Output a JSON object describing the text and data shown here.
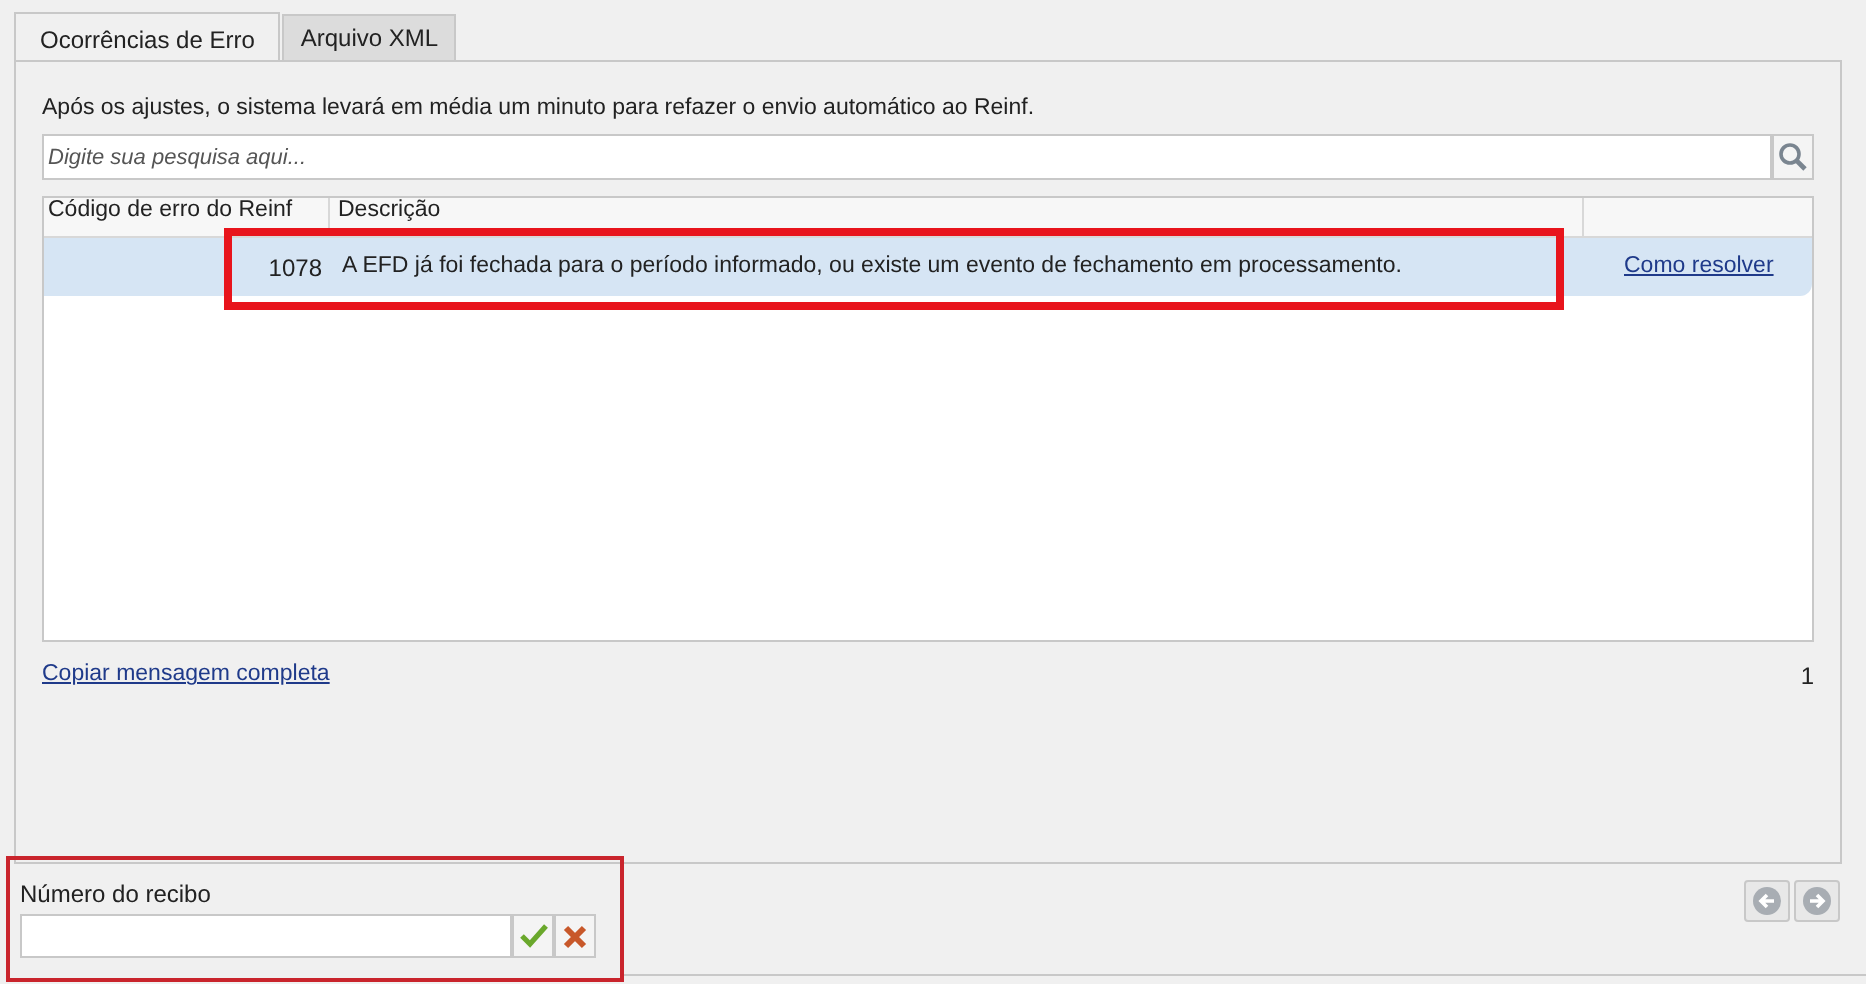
{
  "tabs": [
    {
      "label": "Ocorrências de Erro",
      "selected": true
    },
    {
      "label": "Arquivo XML",
      "selected": false
    }
  ],
  "info_text": "Após os ajustes, o sistema levará em média um minuto para refazer o envio automático ao Reinf.",
  "search": {
    "placeholder": "Digite sua pesquisa aqui..."
  },
  "table": {
    "columns": [
      "Código de erro do Reinf",
      "Descrição"
    ],
    "rows": [
      {
        "code": "1078",
        "description": "A EFD já foi fechada para o período informado, ou existe um evento de fechamento em processamento.",
        "link": "Como resolver",
        "selected": true
      }
    ]
  },
  "copy_link": "Copiar mensagem completa",
  "count": "1",
  "receipt": {
    "label": "Número do recibo"
  }
}
